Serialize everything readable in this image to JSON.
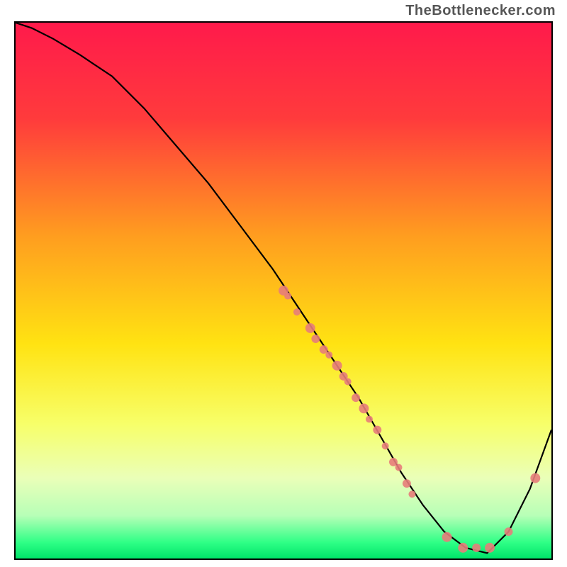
{
  "attribution": "TheBottlenecker.com",
  "gradient_stops": [
    {
      "pct": 0,
      "color": "#ff1a4b"
    },
    {
      "pct": 18,
      "color": "#ff3b3c"
    },
    {
      "pct": 40,
      "color": "#ff9e1f"
    },
    {
      "pct": 60,
      "color": "#ffe312"
    },
    {
      "pct": 75,
      "color": "#f7ff6a"
    },
    {
      "pct": 85,
      "color": "#eaffb8"
    },
    {
      "pct": 92,
      "color": "#b7ffb7"
    },
    {
      "pct": 97,
      "color": "#2fff86"
    },
    {
      "pct": 100,
      "color": "#00e56a"
    }
  ],
  "chart_data": {
    "type": "line",
    "title": "",
    "xlabel": "",
    "ylabel": "",
    "xlim": [
      0,
      100
    ],
    "ylim": [
      0,
      100
    ],
    "series": [
      {
        "name": "bottleneck-curve",
        "x": [
          0,
          3,
          7,
          12,
          18,
          24,
          30,
          36,
          42,
          48,
          52,
          56,
          60,
          64,
          68,
          72,
          76,
          80,
          84,
          88,
          92,
          96,
          100
        ],
        "y": [
          100,
          99,
          97,
          94,
          90,
          84,
          77,
          70,
          62,
          54,
          48,
          42,
          36,
          30,
          23,
          16,
          10,
          5,
          2,
          1,
          5,
          13,
          24
        ]
      }
    ],
    "markers": [
      {
        "x": 50.0,
        "y": 50,
        "r": 7
      },
      {
        "x": 50.8,
        "y": 49,
        "r": 5
      },
      {
        "x": 52.5,
        "y": 46,
        "r": 5
      },
      {
        "x": 55.0,
        "y": 43,
        "r": 7
      },
      {
        "x": 56.0,
        "y": 41,
        "r": 6
      },
      {
        "x": 57.5,
        "y": 39,
        "r": 6
      },
      {
        "x": 58.5,
        "y": 38,
        "r": 5
      },
      {
        "x": 60.0,
        "y": 36,
        "r": 7
      },
      {
        "x": 61.2,
        "y": 34,
        "r": 6
      },
      {
        "x": 62.0,
        "y": 33,
        "r": 5
      },
      {
        "x": 63.5,
        "y": 30,
        "r": 6
      },
      {
        "x": 65.0,
        "y": 28,
        "r": 7
      },
      {
        "x": 66.0,
        "y": 26,
        "r": 5
      },
      {
        "x": 67.5,
        "y": 24,
        "r": 6
      },
      {
        "x": 69.0,
        "y": 21,
        "r": 5
      },
      {
        "x": 70.5,
        "y": 18,
        "r": 6
      },
      {
        "x": 71.5,
        "y": 17,
        "r": 5
      },
      {
        "x": 73.0,
        "y": 14,
        "r": 6
      },
      {
        "x": 74.0,
        "y": 12,
        "r": 5
      },
      {
        "x": 80.5,
        "y": 4,
        "r": 7
      },
      {
        "x": 83.5,
        "y": 2,
        "r": 7
      },
      {
        "x": 86.0,
        "y": 2,
        "r": 6
      },
      {
        "x": 88.5,
        "y": 2,
        "r": 7
      },
      {
        "x": 92.0,
        "y": 5,
        "r": 6
      },
      {
        "x": 97.0,
        "y": 15,
        "r": 7
      }
    ],
    "marker_color": "#e77d7a"
  }
}
